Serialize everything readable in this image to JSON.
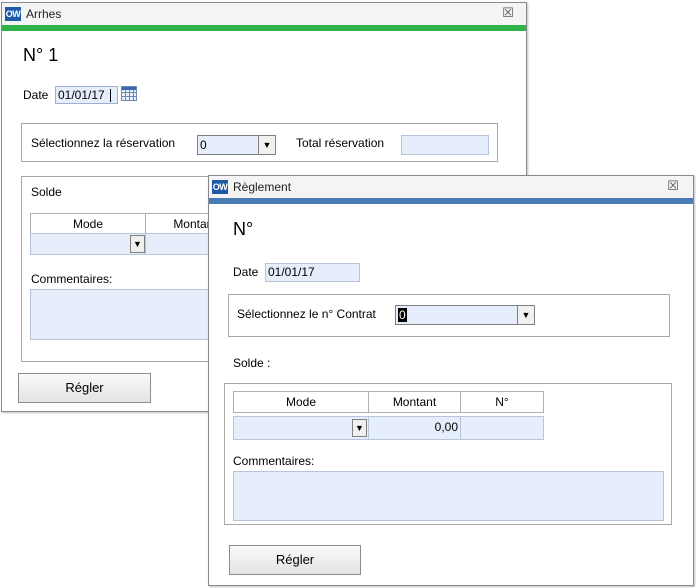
{
  "arrhes": {
    "title": "Arrhes",
    "close_glyph": "☒",
    "heading": "N° 1",
    "date_label": "Date",
    "date_value": "01/01/17",
    "select_reservation_label": "Sélectionnez la réservation",
    "reservation_value": "0",
    "total_label": "Total réservation",
    "total_value": "",
    "solde_label": "Solde",
    "col_mode": "Mode",
    "col_montant": "Montant",
    "comments_label": "Commentaires:",
    "button_label": "Régler",
    "accent_color": "#2fb34a"
  },
  "reglement": {
    "title": "Règlement",
    "close_glyph": "☒",
    "heading": "N°",
    "date_label": "Date",
    "date_value": "01/01/17",
    "select_contract_label": "Sélectionnez le n° Contrat",
    "contract_value": "0",
    "solde_label": "Solde :",
    "col_mode": "Mode",
    "col_montant": "Montant",
    "col_no": "N°",
    "montant_value": "0,00",
    "comments_label": "Commentaires:",
    "button_label": "Régler",
    "accent_color": "#4a7bb5"
  },
  "logo_text": "OW",
  "dropdown_arrow": "▼"
}
